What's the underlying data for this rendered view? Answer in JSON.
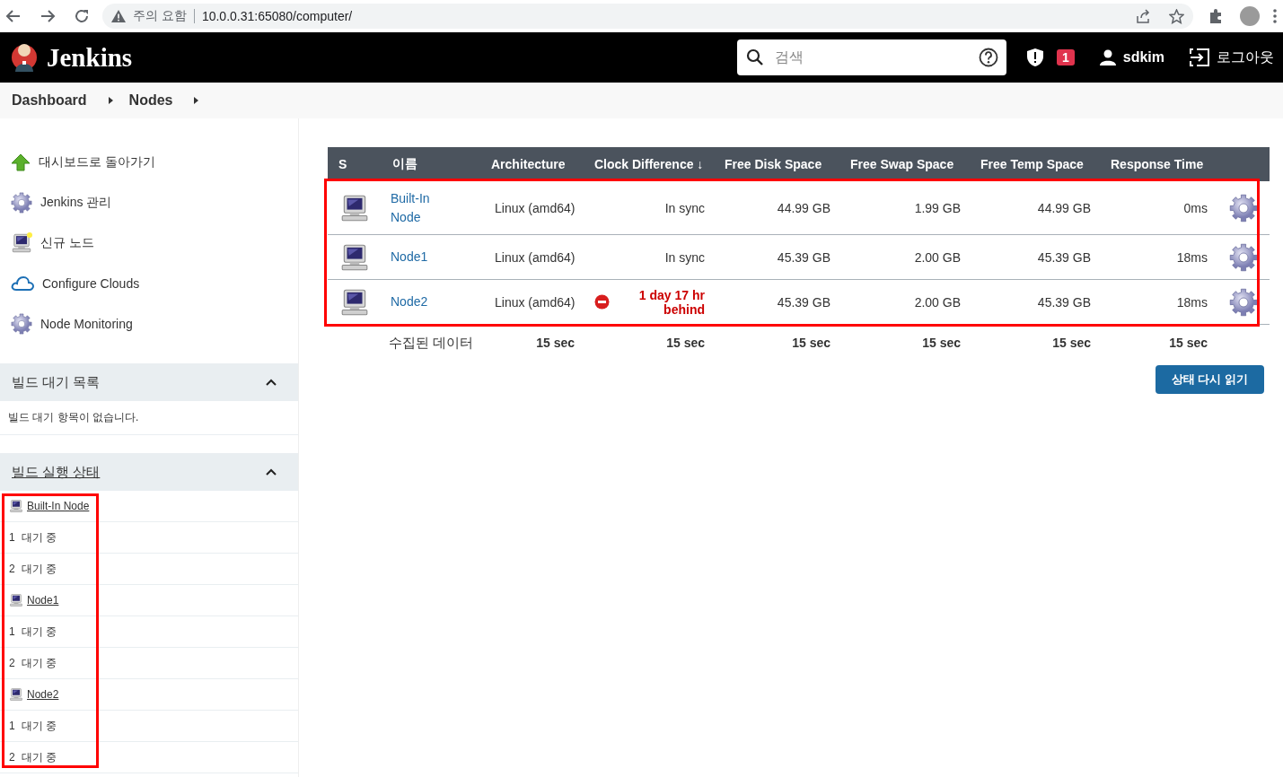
{
  "browser": {
    "warning_label": "주의 요함",
    "url": "10.0.0.31:65080/computer/"
  },
  "header": {
    "logo_text": "Jenkins",
    "search": {
      "placeholder": "검색"
    },
    "security_badge": "1",
    "user": "sdkim",
    "logout": "로그아웃"
  },
  "breadcrumbs": [
    "Dashboard",
    "Nodes"
  ],
  "sidebar": {
    "tasks": [
      {
        "label": "대시보드로 돌아가기",
        "kind": "up-arrow"
      },
      {
        "label": "Jenkins 관리",
        "kind": "gear"
      },
      {
        "label": "신규 노드",
        "kind": "new-computer"
      },
      {
        "label": "Configure Clouds",
        "kind": "cloud"
      },
      {
        "label": "Node Monitoring",
        "kind": "gear"
      }
    ]
  },
  "build_queue": {
    "title": "빌드 대기 목록",
    "expanded": true,
    "empty_text": "빌드 대기 항목이 없습니다."
  },
  "executor_status": {
    "title": "빌드 실행 상태",
    "expanded": true,
    "highlighted": true,
    "computers": [
      {
        "name": "Built-In Node",
        "executors": [
          {
            "number": "1",
            "status": "대기 중"
          },
          {
            "number": "2",
            "status": "대기 중"
          }
        ]
      },
      {
        "name": "Node1",
        "executors": [
          {
            "number": "1",
            "status": "대기 중"
          },
          {
            "number": "2",
            "status": "대기 중"
          }
        ]
      },
      {
        "name": "Node2",
        "executors": [
          {
            "number": "1",
            "status": "대기 중"
          },
          {
            "number": "2",
            "status": "대기 중"
          }
        ]
      }
    ]
  },
  "nodes_table": {
    "highlighted": true,
    "columns": [
      "S",
      "이름",
      "Architecture",
      "Clock Difference ↓",
      "Free Disk Space",
      "Free Swap Space",
      "Free Temp Space",
      "Response Time"
    ],
    "rows": [
      {
        "name": "Built-In Node",
        "architecture": "Linux (amd64)",
        "clock_difference": "In sync",
        "clock_warning": false,
        "free_disk": "44.99 GB",
        "free_swap": "1.99 GB",
        "free_temp": "44.99 GB",
        "response_time": "0ms"
      },
      {
        "name": "Node1",
        "architecture": "Linux (amd64)",
        "clock_difference": "In sync",
        "clock_warning": false,
        "free_disk": "45.39 GB",
        "free_swap": "2.00 GB",
        "free_temp": "45.39 GB",
        "response_time": "18ms"
      },
      {
        "name": "Node2",
        "architecture": "Linux (amd64)",
        "clock_difference": "1 day 17 hr behind",
        "clock_warning": true,
        "free_disk": "45.39 GB",
        "free_swap": "2.00 GB",
        "free_temp": "45.39 GB",
        "response_time": "18ms"
      }
    ],
    "footer": {
      "label": "수집된 데이터",
      "values": [
        "15 sec",
        "15 sec",
        "15 sec",
        "15 sec",
        "15 sec",
        "15 sec"
      ]
    }
  },
  "refresh_button": "상태 다시 읽기"
}
